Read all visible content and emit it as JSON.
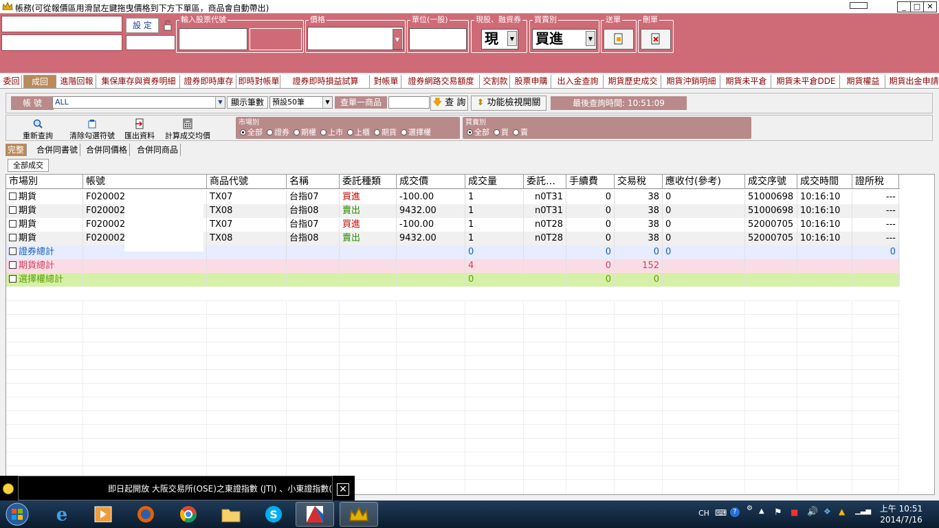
{
  "window": {
    "title": "帳務(可從報價區用滑鼠左鍵拖曳價格到下方下單區，商品會自動帶出)"
  },
  "order": {
    "set_label": "設 定",
    "stock_code_label": "輸入股票代號",
    "price_label": "價格",
    "unit_label": "單位(一股)",
    "cash_margin_label": "現股、融資券",
    "cash_margin_value": "現",
    "buy_sell_label": "買賣別",
    "buy_sell_value": "買進",
    "send_label": "送單",
    "delete_label": "刪單"
  },
  "tabs": [
    "委回",
    "成回",
    "進階回報",
    "集保庫存與資券明細",
    "證券即時庫存",
    "即時對帳單",
    "證券即時損益試算",
    "對帳單",
    "證券網路交易額度",
    "交割款",
    "股票申購",
    "出入金查詢",
    "期貨歷史成交",
    "期貨沖銷明細",
    "期貨未平倉",
    "期貨未平倉DDE",
    "期貨權益",
    "期貨出金申請"
  ],
  "filter": {
    "account_label": "帳 號",
    "account_value": "ALL",
    "show_count_label": "顯示筆數",
    "show_count_value": "預設50筆",
    "query_one_label": "查單一商品",
    "query_btn": "查 詢",
    "toggle_btn": "功能檢視開關",
    "last_query": "最後查詢時間: 10:51:09"
  },
  "toolbar": {
    "requery": "重新查詢",
    "clear": "清除勾選符號",
    "export": "匯出資料",
    "calc": "計算成交均價",
    "market_label": "市場別",
    "market_options": [
      "全部",
      "證券",
      "期權",
      "上市",
      "上櫃",
      "期貨",
      "選擇權"
    ],
    "side_label": "買賣別",
    "side_options": [
      "全部",
      "買",
      "賣"
    ]
  },
  "subtabs": [
    "完整",
    "合併同書號",
    "合併同價格",
    "合併同商品"
  ],
  "all_trades": "全部成交",
  "grid": {
    "headers": [
      "市場別",
      "帳號",
      "商品代號",
      "名稱",
      "委託種類",
      "成交價",
      "成交量",
      "委託…",
      "手續費",
      "交易稅",
      "應收付(參考)",
      "成交序號",
      "成交時間",
      "證所稅"
    ],
    "rows": [
      {
        "market": "期貨",
        "account": "F020002",
        "code": "TX07",
        "name": "台指07",
        "type": "買進",
        "price": "-100.00",
        "qty": "1",
        "order": "n0T31",
        "fee": "0",
        "tax": "38",
        "recv": "0",
        "seq": "51000698",
        "time": "10:16:10",
        "stax": "---"
      },
      {
        "market": "期貨",
        "account": "F020002",
        "code": "TX08",
        "name": "台指08",
        "type": "賣出",
        "price": "9432.00",
        "qty": "1",
        "order": "n0T31",
        "fee": "0",
        "tax": "38",
        "recv": "0",
        "seq": "51000698",
        "time": "10:16:10",
        "stax": "---"
      },
      {
        "market": "期貨",
        "account": "F020002",
        "code": "TX07",
        "name": "台指07",
        "type": "買進",
        "price": "-100.00",
        "qty": "1",
        "order": "n0T28",
        "fee": "0",
        "tax": "38",
        "recv": "0",
        "seq": "52000705",
        "time": "10:16:10",
        "stax": "---"
      },
      {
        "market": "期貨",
        "account": "F020002",
        "code": "TX08",
        "name": "台指08",
        "type": "賣出",
        "price": "9432.00",
        "qty": "1",
        "order": "n0T28",
        "fee": "0",
        "tax": "38",
        "recv": "0",
        "seq": "52000705",
        "time": "10:16:10",
        "stax": "---"
      }
    ],
    "totals": [
      {
        "label": "證券總計",
        "qty": "0",
        "fee": "0",
        "tax": "0",
        "recv": "0",
        "stax": "0"
      },
      {
        "label": "期貨總計",
        "qty": "4",
        "fee": "0",
        "tax": "152"
      },
      {
        "label": "選擇權總計",
        "qty": "0",
        "fee": "0",
        "tax": "0"
      }
    ]
  },
  "ticker": {
    "text": "即日起開放 大阪交易所(OSE)之東證指數 (JTI) 、小東證指數("
  },
  "tray": {
    "lang": "CH"
  },
  "clock": {
    "time": "上午 10:51",
    "date": "2014/7/16"
  },
  "colors": {
    "header_bg": "#cf6b76",
    "buy": "#cc0000",
    "sell": "#2a8a00",
    "sec_total": "#1a5fb4",
    "fut_total": "#d04060",
    "opt_total": "#5aa000"
  }
}
